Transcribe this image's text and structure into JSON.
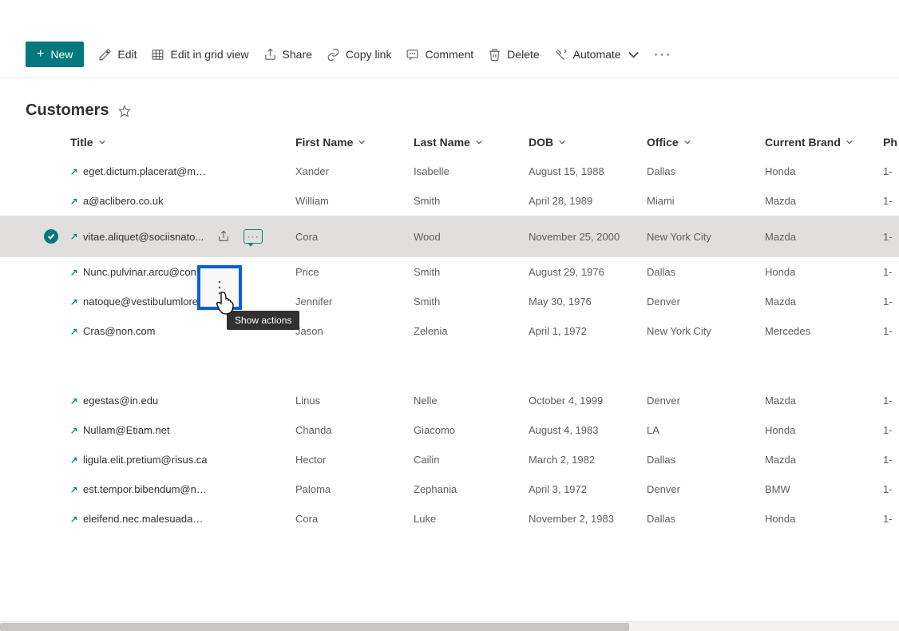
{
  "toolbar": {
    "new_label": "New",
    "edit_label": "Edit",
    "grid_label": "Edit in grid view",
    "share_label": "Share",
    "copy_label": "Copy link",
    "comment_label": "Comment",
    "delete_label": "Delete",
    "automate_label": "Automate"
  },
  "page": {
    "title": "Customers"
  },
  "columns": {
    "title": "Title",
    "first": "First Name",
    "last": "Last Name",
    "dob": "DOB",
    "office": "Office",
    "brand": "Current Brand",
    "phone": "Ph"
  },
  "tooltip": {
    "show_actions": "Show actions"
  },
  "rows": [
    {
      "title": "eget.dictum.placerat@mattis.ca",
      "first": "Xander",
      "last": "Isabelle",
      "dob": "August 15, 1988",
      "office": "Dallas",
      "brand": "Honda",
      "phone": "1-"
    },
    {
      "title": "a@aclibero.co.uk",
      "first": "William",
      "last": "Smith",
      "dob": "April 28, 1989",
      "office": "Miami",
      "brand": "Mazda",
      "phone": "1-"
    },
    {
      "title": "vitae.aliquet@sociisnato...",
      "first": "Cora",
      "last": "Wood",
      "dob": "November 25, 2000",
      "office": "New York City",
      "brand": "Mazda",
      "phone": "1-",
      "selected": true,
      "truncate": false
    },
    {
      "title": "Nunc.pulvinar.arcu@conubianos...",
      "first": "Price",
      "last": "Smith",
      "dob": "August 29, 1976",
      "office": "Dallas",
      "brand": "Honda",
      "phone": "1-"
    },
    {
      "title": "natoque@vestibulumlorem.edu",
      "first": "Jennifer",
      "last": "Smith",
      "dob": "May 30, 1976",
      "office": "Denver",
      "brand": "Mazda",
      "phone": "1-"
    },
    {
      "title": "Cras@non.com",
      "first": "Jason",
      "last": "Zelenia",
      "dob": "April 1, 1972",
      "office": "New York City",
      "brand": "Mercedes",
      "phone": "1-"
    },
    {
      "gap": true
    },
    {
      "title": "egestas@in.edu",
      "first": "Linus",
      "last": "Nelle",
      "dob": "October 4, 1999",
      "office": "Denver",
      "brand": "Mazda",
      "phone": "1-"
    },
    {
      "title": "Nullam@Etiam.net",
      "first": "Chanda",
      "last": "Giacomo",
      "dob": "August 4, 1983",
      "office": "LA",
      "brand": "Honda",
      "phone": "1-"
    },
    {
      "title": "ligula.elit.pretium@risus.ca",
      "first": "Hector",
      "last": "Cailin",
      "dob": "March 2, 1982",
      "office": "Dallas",
      "brand": "Mazda",
      "phone": "1-"
    },
    {
      "title": "est.tempor.bibendum@neccursusa.com",
      "first": "Paloma",
      "last": "Zephania",
      "dob": "April 3, 1972",
      "office": "Denver",
      "brand": "BMW",
      "phone": "1-"
    },
    {
      "title": "eleifend.nec.malesuada@atrisus.ca",
      "first": "Cora",
      "last": "Luke",
      "dob": "November 2, 1983",
      "office": "Dallas",
      "brand": "Honda",
      "phone": "1-"
    }
  ]
}
